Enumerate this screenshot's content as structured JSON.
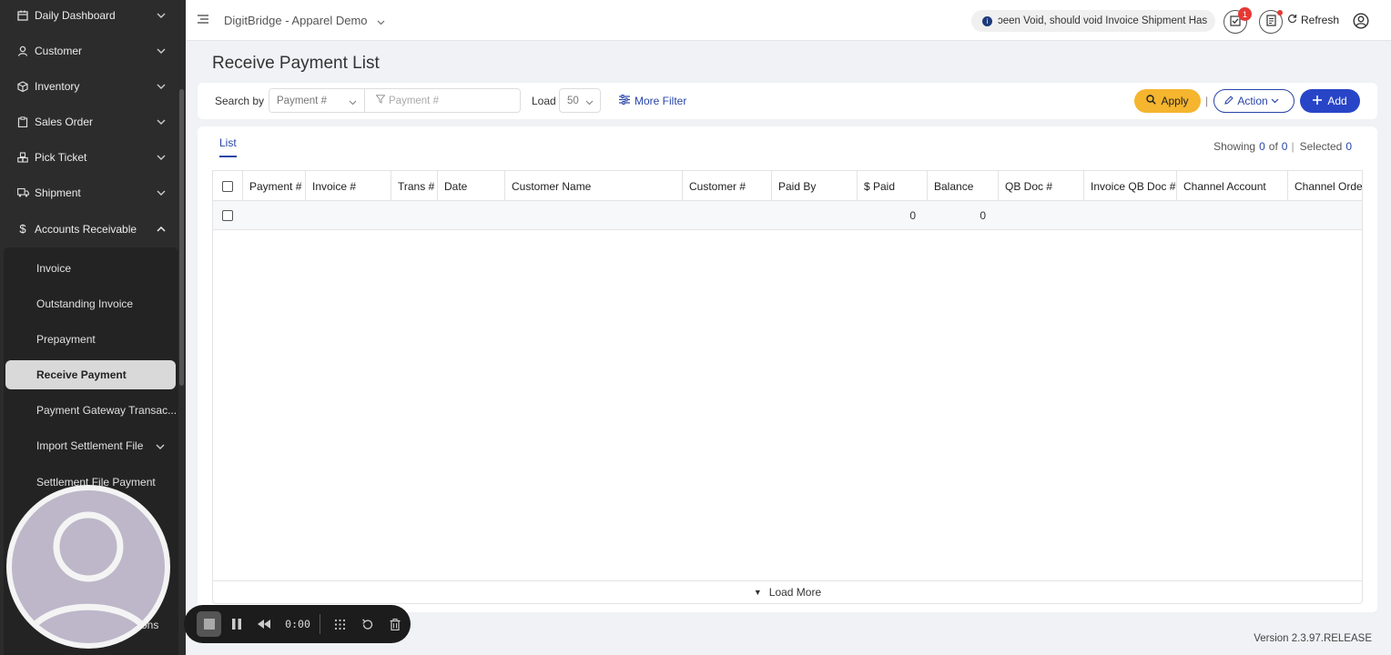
{
  "sidebar": {
    "items": [
      {
        "label": "Daily Dashboard",
        "icon": "calendar-icon"
      },
      {
        "label": "Customer",
        "icon": "person-icon"
      },
      {
        "label": "Inventory",
        "icon": "box-icon"
      },
      {
        "label": "Sales Order",
        "icon": "clipboard-icon"
      },
      {
        "label": "Pick Ticket",
        "icon": "boxes-icon"
      },
      {
        "label": "Shipment",
        "icon": "truck-icon"
      },
      {
        "label": "Accounts Receivable",
        "icon": "dollar-icon"
      }
    ],
    "subitems": [
      {
        "label": "Invoice"
      },
      {
        "label": "Outstanding Invoice"
      },
      {
        "label": "Prepayment"
      },
      {
        "label": "Receive Payment"
      },
      {
        "label": "Payment Gateway Transac..."
      },
      {
        "label": "Import Settlement File"
      },
      {
        "label": "Settlement File Payment"
      }
    ],
    "partial_text": "ons"
  },
  "header": {
    "app_title": "DigitBridge - Apparel Demo",
    "notice": "ɔeen Void, should void Invoice  Shipment Has",
    "badge_count": "1",
    "refresh_label": "Refresh"
  },
  "page": {
    "title": "Receive Payment List",
    "search_by_label": "Search by",
    "search_field": "Payment #",
    "search_placeholder": "Payment #",
    "load_label": "Load",
    "load_value": "50",
    "more_filter": "More Filter",
    "apply": "Apply",
    "action": "Action",
    "add": "Add",
    "tab": "List",
    "showing_label": "Showing",
    "showing_from": "0",
    "of_label": "of",
    "showing_total": "0",
    "selected_label": "Selected",
    "selected_count": "0",
    "load_more": "Load More",
    "version": "Version 2.3.97.RELEASE"
  },
  "table": {
    "columns": [
      "Payment #",
      "Invoice #",
      "Trans #",
      "Date",
      "Customer Name",
      "Customer #",
      "Paid By",
      "$ Paid",
      "Balance",
      "QB Doc #",
      "Invoice QB Doc #",
      "Channel Account",
      "Channel Order"
    ],
    "row": {
      "paid": "0",
      "balance": "0"
    }
  },
  "recorder": {
    "time": "0:00"
  }
}
